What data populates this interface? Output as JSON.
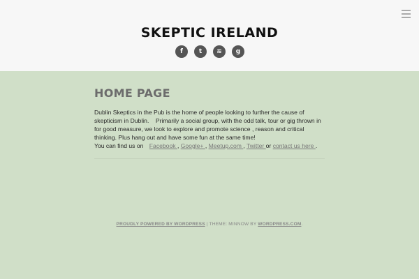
{
  "header": {
    "site_title": "SKEPTIC IRELAND",
    "social": [
      {
        "icon": "facebook-icon",
        "glyph": "f"
      },
      {
        "icon": "twitter-icon",
        "glyph": "t"
      },
      {
        "icon": "meetup-icon",
        "glyph": "≋"
      },
      {
        "icon": "google-plus-icon",
        "glyph": "g"
      }
    ]
  },
  "main": {
    "title": "HOME PAGE",
    "paragraph": {
      "text1": "Dublin Skeptics in the Pub is the home of people looking to further the cause of skepticism in Dublin.    Primarily a social group, with the odd talk, tour or gig thrown in for good measure, we look to explore and promote science , reason and critical thinking. Plus hang out and have some fun at the same time!",
      "find_us": "You can find us on",
      "facebook": "Facebook ",
      "google": "Google+ ",
      "meetup": "Meetup.com ",
      "twitter": "Twitter ",
      "or": "or",
      "contact": "contact us here ",
      "end": "."
    }
  },
  "footer": {
    "powered": "PROUDLY POWERED BY WORDPRESS",
    "sep": " | THEME: MINNOW BY ",
    "wpcom": "WORDPRESS.COM",
    "end": "."
  },
  "colors": {
    "background": "#d0dfc8",
    "header_bg": "#f7f7f7",
    "social_icon_bg": "#555555"
  }
}
